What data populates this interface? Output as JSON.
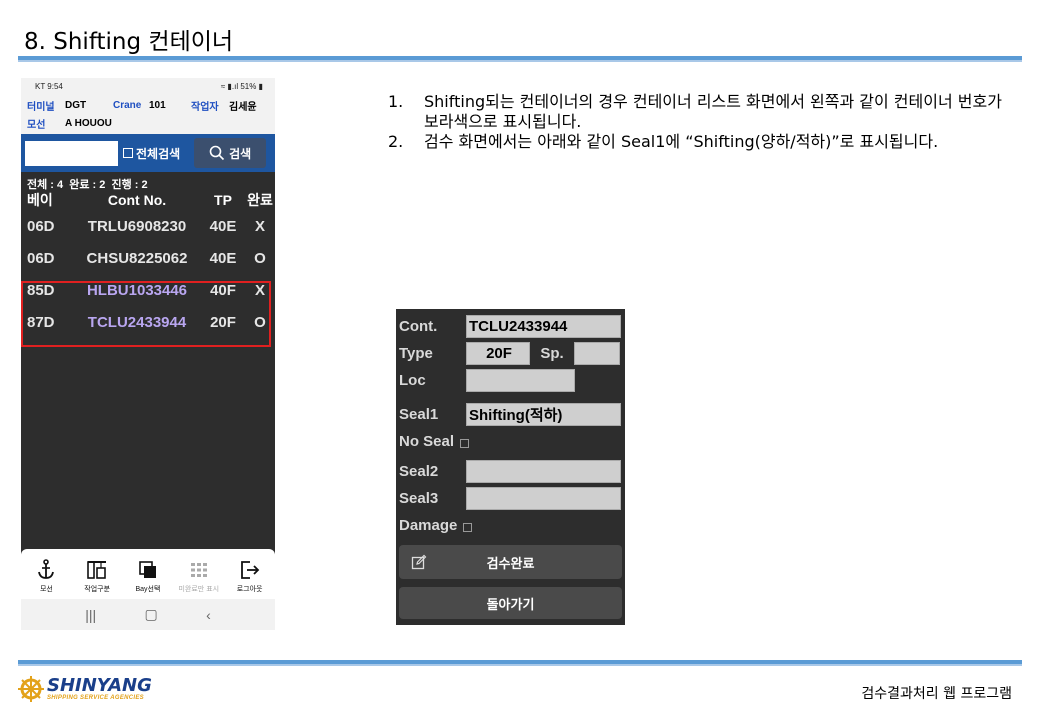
{
  "slide": {
    "title": "8. Shifting 컨테이너",
    "footer_title": "검수결과처리 웹 프로그램"
  },
  "logo": {
    "name": "SHINYANG",
    "sub": "SHIPPING SERVICE AGENCIES"
  },
  "phone": {
    "status": {
      "carrier_time": "KT 9:54",
      "indicators": "51%"
    },
    "header": {
      "terminal_label": "터미널",
      "terminal_value": "DGT",
      "crane_label": "Crane",
      "crane_value": "101",
      "worker_label": "작업자",
      "worker_value": "김세윤",
      "vessel_label": "모선",
      "vessel_value": "A HOUOU"
    },
    "search": {
      "check_all_label": "전체검색",
      "search_button": "검색"
    },
    "summary": "전체 : 4  완료 : 2  진행 : 2",
    "columns": {
      "bay": "베이",
      "cont": "Cont No.",
      "tp": "TP",
      "done": "완료"
    },
    "rows": [
      {
        "bay": "06D",
        "cont": "TRLU6908230",
        "tp": "40E",
        "done": "X"
      },
      {
        "bay": "06D",
        "cont": "CHSU8225062",
        "tp": "40E",
        "done": "O"
      },
      {
        "bay": "85D",
        "cont": "HLBU1033446",
        "tp": "40F",
        "done": "X"
      },
      {
        "bay": "87D",
        "cont": "TCLU2433944",
        "tp": "20F",
        "done": "O"
      }
    ],
    "nav": [
      {
        "label": "모선",
        "icon": "anchor-icon"
      },
      {
        "label": "작업구분",
        "icon": "crane-icon"
      },
      {
        "label": "Bay선택",
        "icon": "layers-icon"
      },
      {
        "label": "미완료만 표시",
        "icon": "grid-icon"
      },
      {
        "label": "로그아웃",
        "icon": "logout-icon"
      }
    ]
  },
  "instructions": [
    {
      "num": "1.",
      "text": "Shifting되는 컨테이너의 경우 컨테이너 리스트 화면에서 왼쪽과 같이 컨테이너 번호가 보라색으로 표시됩니다."
    },
    {
      "num": "2.",
      "text": "검수 화면에서는 아래와 같이 Seal1에 “Shifting(양하/적하)”로 표시됩니다."
    }
  ],
  "inspect": {
    "cont_label": "Cont.",
    "cont_value": "TCLU2433944",
    "type_label": "Type",
    "type_value": "20F",
    "sp_label": "Sp.",
    "sp_value": "",
    "loc_label": "Loc",
    "loc_value": "",
    "seal1_label": "Seal1",
    "seal1_value": "Shifting(적하)",
    "noseal_label": "No Seal",
    "seal2_label": "Seal2",
    "seal2_value": "",
    "seal3_label": "Seal3",
    "seal3_value": "",
    "damage_label": "Damage",
    "complete_button": "검수완료",
    "back_button": "돌아가기"
  }
}
